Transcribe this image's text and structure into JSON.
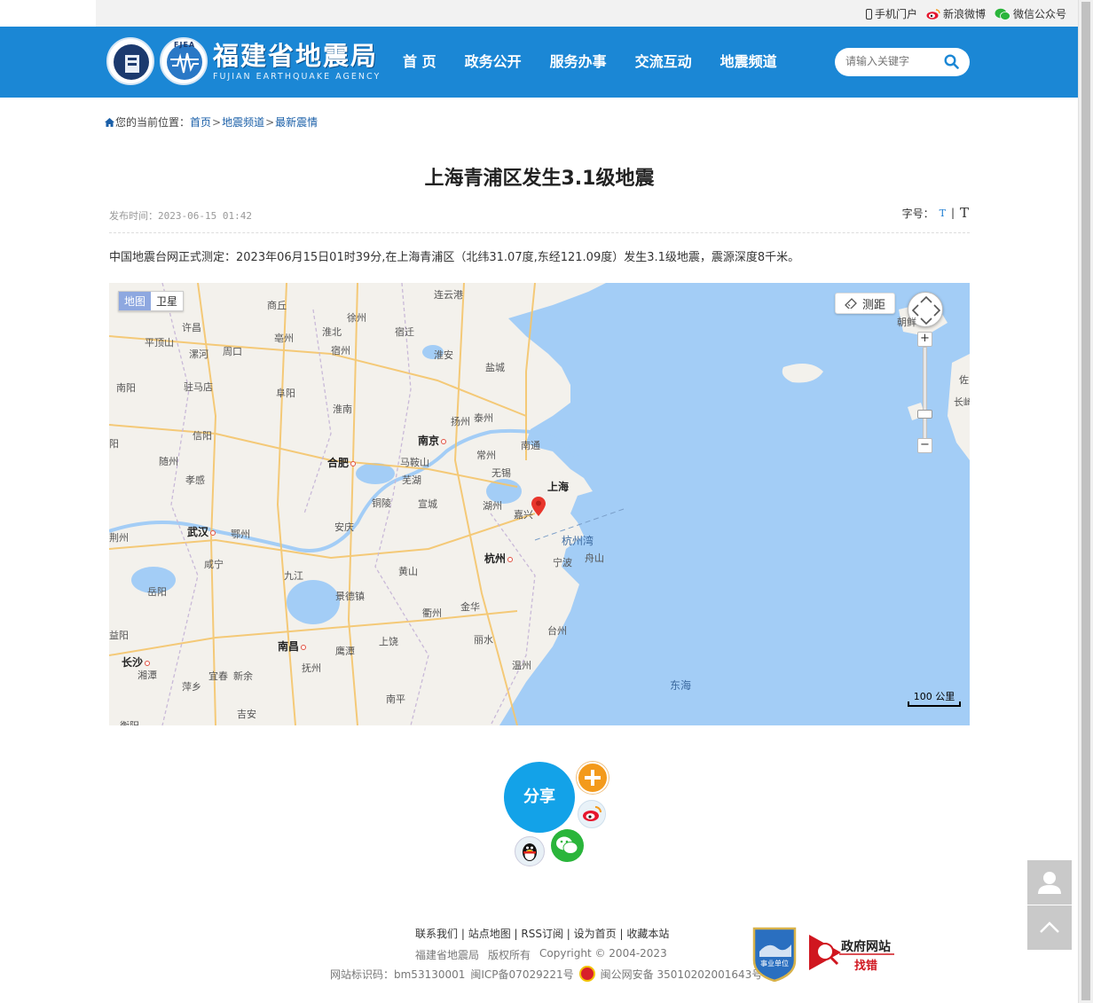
{
  "topbar": {
    "mobile_label": "手机门户",
    "weibo_label": "新浪微博",
    "wechat_label": "微信公众号"
  },
  "header": {
    "site_name": "福建省地震局",
    "site_name_en": "FUJIAN EARTHQUAKE AGENCY",
    "emblem_text": "FJEA",
    "search_placeholder": "请输入关键字"
  },
  "nav": {
    "items": [
      {
        "label": "首 页"
      },
      {
        "label": "政务公开"
      },
      {
        "label": "服务办事"
      },
      {
        "label": "交流互动"
      },
      {
        "label": "地震频道"
      }
    ]
  },
  "breadcrumb": {
    "prefix": "您的当前位置：",
    "items": [
      "首页",
      "地震频道",
      "最新震情"
    ],
    "separator": ">"
  },
  "article": {
    "title": "上海青浦区发生3.1级地震",
    "publish_label": "发布时间：",
    "publish_time": "2023-06-15 01:42",
    "font_size_label": "字号：",
    "font_small": "T",
    "font_sep": "|",
    "font_big": "T",
    "body": "中国地震台网正式测定：2023年06月15日01时39分,在上海青浦区（北纬31.07度,东经121.09度）发生3.1级地震，震源深度8千米。"
  },
  "map": {
    "type_map": "地图",
    "type_satellite": "卫星",
    "measure_label": "测距",
    "zoom_in": "+",
    "zoom_out": "−",
    "scale_label": "100 公里",
    "sea_color": "#a3cdf6",
    "land_color": "#f3f1ec",
    "cities": [
      {
        "name": "连云港",
        "major": false
      },
      {
        "name": "商丘",
        "major": false
      },
      {
        "name": "徐州",
        "major": false
      },
      {
        "name": "许昌",
        "major": false
      },
      {
        "name": "淮北",
        "major": false
      },
      {
        "name": "宿迁",
        "major": false
      },
      {
        "name": "平顶山",
        "major": false
      },
      {
        "name": "亳州",
        "major": false
      },
      {
        "name": "漯河",
        "major": false
      },
      {
        "name": "周口",
        "major": false
      },
      {
        "name": "宿州",
        "major": false
      },
      {
        "name": "淮安",
        "major": false
      },
      {
        "name": "盐城",
        "major": false
      },
      {
        "name": "南阳",
        "major": false
      },
      {
        "name": "驻马店",
        "major": false
      },
      {
        "name": "阜阳",
        "major": false
      },
      {
        "name": "淮南",
        "major": false
      },
      {
        "name": "扬州",
        "major": false
      },
      {
        "name": "泰州",
        "major": false
      },
      {
        "name": "信阳",
        "major": false
      },
      {
        "name": "南京",
        "major": true
      },
      {
        "name": "南通",
        "major": false
      },
      {
        "name": "随州",
        "major": false
      },
      {
        "name": "合肥",
        "major": true
      },
      {
        "name": "马鞍山",
        "major": false
      },
      {
        "name": "常州",
        "major": false
      },
      {
        "name": "无锡",
        "major": false
      },
      {
        "name": "芜湖",
        "major": false
      },
      {
        "name": "上海",
        "major": true
      },
      {
        "name": "孝感",
        "major": false
      },
      {
        "name": "铜陵",
        "major": false
      },
      {
        "name": "宣城",
        "major": false
      },
      {
        "name": "湖州",
        "major": false
      },
      {
        "name": "嘉兴",
        "major": false
      },
      {
        "name": "武汉",
        "major": true
      },
      {
        "name": "鄂州",
        "major": false
      },
      {
        "name": "安庆",
        "major": false
      },
      {
        "name": "杭州湾",
        "major": false
      },
      {
        "name": "杭州",
        "major": true
      },
      {
        "name": "舟山",
        "major": false
      },
      {
        "name": "咸宁",
        "major": false
      },
      {
        "name": "宁波",
        "major": false
      },
      {
        "name": "黄山",
        "major": false
      },
      {
        "name": "九江",
        "major": false
      },
      {
        "name": "岳阳",
        "major": false
      },
      {
        "name": "景德镇",
        "major": false
      },
      {
        "name": "金华",
        "major": false
      },
      {
        "name": "衢州",
        "major": false
      },
      {
        "name": "益阳",
        "major": false
      },
      {
        "name": "南昌",
        "major": true
      },
      {
        "name": "上饶",
        "major": false
      },
      {
        "name": "丽水",
        "major": false
      },
      {
        "name": "台州",
        "major": false
      },
      {
        "name": "长沙",
        "major": true
      },
      {
        "name": "鹰潭",
        "major": false
      },
      {
        "name": "温州",
        "major": false
      },
      {
        "name": "抚州",
        "major": false
      },
      {
        "name": "湘潭",
        "major": false
      },
      {
        "name": "宜春",
        "major": false
      },
      {
        "name": "新余",
        "major": false
      },
      {
        "name": "东海",
        "major": false
      },
      {
        "name": "萍乡",
        "major": false
      },
      {
        "name": "吉安",
        "major": false
      },
      {
        "name": "南平",
        "major": false
      },
      {
        "name": "衡阳",
        "major": false
      },
      {
        "name": "朝鲜",
        "major": false
      },
      {
        "name": "长崎",
        "major": false
      },
      {
        "name": "佐",
        "major": false
      },
      {
        "name": "荆州",
        "major": false
      },
      {
        "name": "阳",
        "major": false
      }
    ]
  },
  "share": {
    "label": "分享"
  },
  "footer": {
    "links": [
      "联系我们",
      "站点地图",
      "RSS订阅",
      "设为首页",
      "收藏本站"
    ],
    "owner": "福建省地震局",
    "rights": "版权所有",
    "copyright": "Copyright © 2004-2023",
    "site_id": "网站标识码：bm53130001",
    "icp": "闽ICP备07029221号",
    "police": "闽公网安备 35010202001643号",
    "badge_org": "事业单位",
    "gov_find_error_1": "政府网站",
    "gov_find_error_2": "找错"
  }
}
